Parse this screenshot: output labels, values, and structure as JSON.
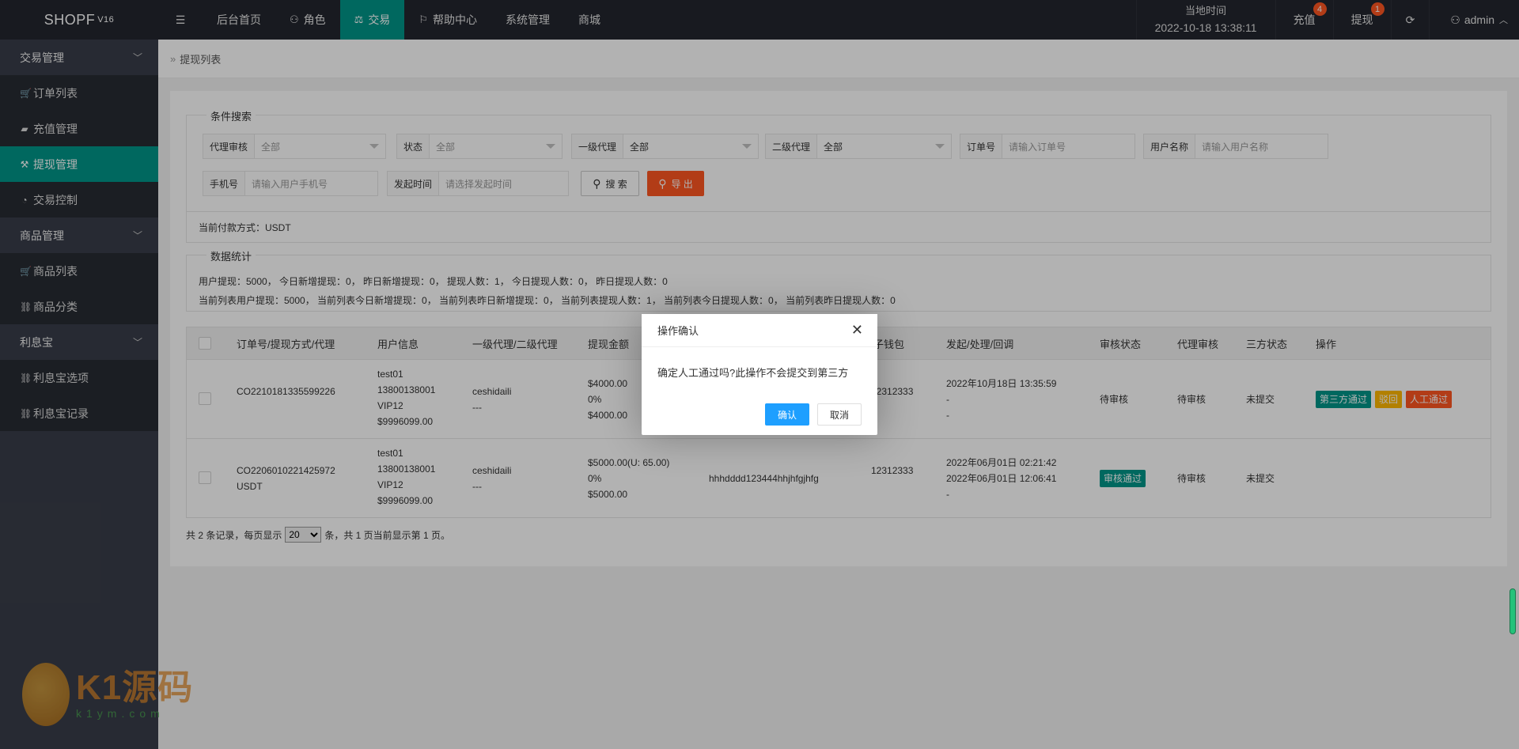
{
  "topbar": {
    "logo": "SHOPF",
    "logo_version": "V16",
    "nav": [
      "后台首页",
      "角色",
      "交易",
      "帮助中心",
      "系统管理",
      "商城"
    ],
    "time_label": "当地时间",
    "time_value": "2022-10-18 13:38:11",
    "recharge_label": "充值",
    "recharge_badge": "4",
    "withdraw_label": "提现",
    "withdraw_badge": "1",
    "user": "admin"
  },
  "sidebar": {
    "group1": "交易管理",
    "items1": [
      "订单列表",
      "充值管理",
      "提现管理",
      "交易控制"
    ],
    "group2": "商品管理",
    "items2": [
      "商品列表",
      "商品分类"
    ],
    "group3": "利息宝",
    "items3": [
      "利息宝选项",
      "利息宝记录"
    ]
  },
  "breadcrumb": "提现列表",
  "search": {
    "legend": "条件搜索",
    "agent_audit_label": "代理审核",
    "agent_audit_value": "全部",
    "status_label": "状态",
    "status_value": "全部",
    "level1_label": "一级代理",
    "level1_value": "全部",
    "level2_label": "二级代理",
    "level2_value": "全部",
    "order_label": "订单号",
    "order_placeholder": "请输入订单号",
    "username_label": "用户名称",
    "username_placeholder": "请输入用户名称",
    "phone_label": "手机号",
    "phone_placeholder": "请输入用户手机号",
    "time_label": "发起时间",
    "time_placeholder": "请选择发起时间",
    "search_btn": "搜 索",
    "export_btn": "导 出"
  },
  "payment_line": "当前付款方式：USDT",
  "stats": {
    "legend": "数据统计",
    "line1": "用户提现：5000， 今日新增提现：0， 昨日新增提现：0， 提现人数：1， 今日提现人数：0， 昨日提现人数：0",
    "line2": "当前列表用户提现：5000， 当前列表今日新增提现：0， 当前列表昨日新增提现：0， 当前列表提现人数：1， 当前列表今日提现人数：0， 当前列表昨日提现人数：0"
  },
  "table": {
    "headers": [
      "订单号/提现方式/代理",
      "用户信息",
      "一级代理/二级代理",
      "提现金额",
      "包子钱包",
      "发起/处理/回调",
      "审核状态",
      "代理审核",
      "三方状态",
      "操作"
    ],
    "rows": [
      {
        "order": "CO2210181335599226",
        "method": "",
        "user": [
          "test01",
          "13800138001",
          "VIP12",
          "$9996099.00"
        ],
        "agents": [
          "ceshidaili",
          "---"
        ],
        "amount": [
          "$4000.00",
          "0%",
          "$4000.00"
        ],
        "address": "",
        "wallet": "12312333",
        "times": [
          "2022年10月18日 13:35:59",
          "-",
          "-"
        ],
        "audit": "待审核",
        "agent_audit": "待审核",
        "third": "未提交",
        "actions": [
          "第三方通过",
          "驳回",
          "人工通过"
        ]
      },
      {
        "order": "CO2206010221425972",
        "method": "USDT",
        "user": [
          "test01",
          "13800138001",
          "VIP12",
          "$9996099.00"
        ],
        "agents": [
          "ceshidaili",
          "---"
        ],
        "amount": [
          "$5000.00(U: 65.00)",
          "0%",
          "$5000.00"
        ],
        "address": "hhhdddd123444hhjhfgjhfg",
        "wallet": "12312333",
        "times": [
          "2022年06月01日 02:21:42",
          "2022年06月01日 12:06:41",
          "-"
        ],
        "audit": "审核通过",
        "agent_audit": "待审核",
        "third": "未提交",
        "actions": []
      }
    ]
  },
  "pager": {
    "prefix": "共 2 条记录，每页显示",
    "size": "20",
    "suffix": "条，共 1 页当前显示第 1 页。"
  },
  "modal": {
    "title": "操作确认",
    "message": "确定人工通过吗?此操作不会提交到第三方",
    "confirm": "确认",
    "cancel": "取消"
  },
  "watermark": {
    "big": "K1源码",
    "small": "k1ym.com"
  }
}
